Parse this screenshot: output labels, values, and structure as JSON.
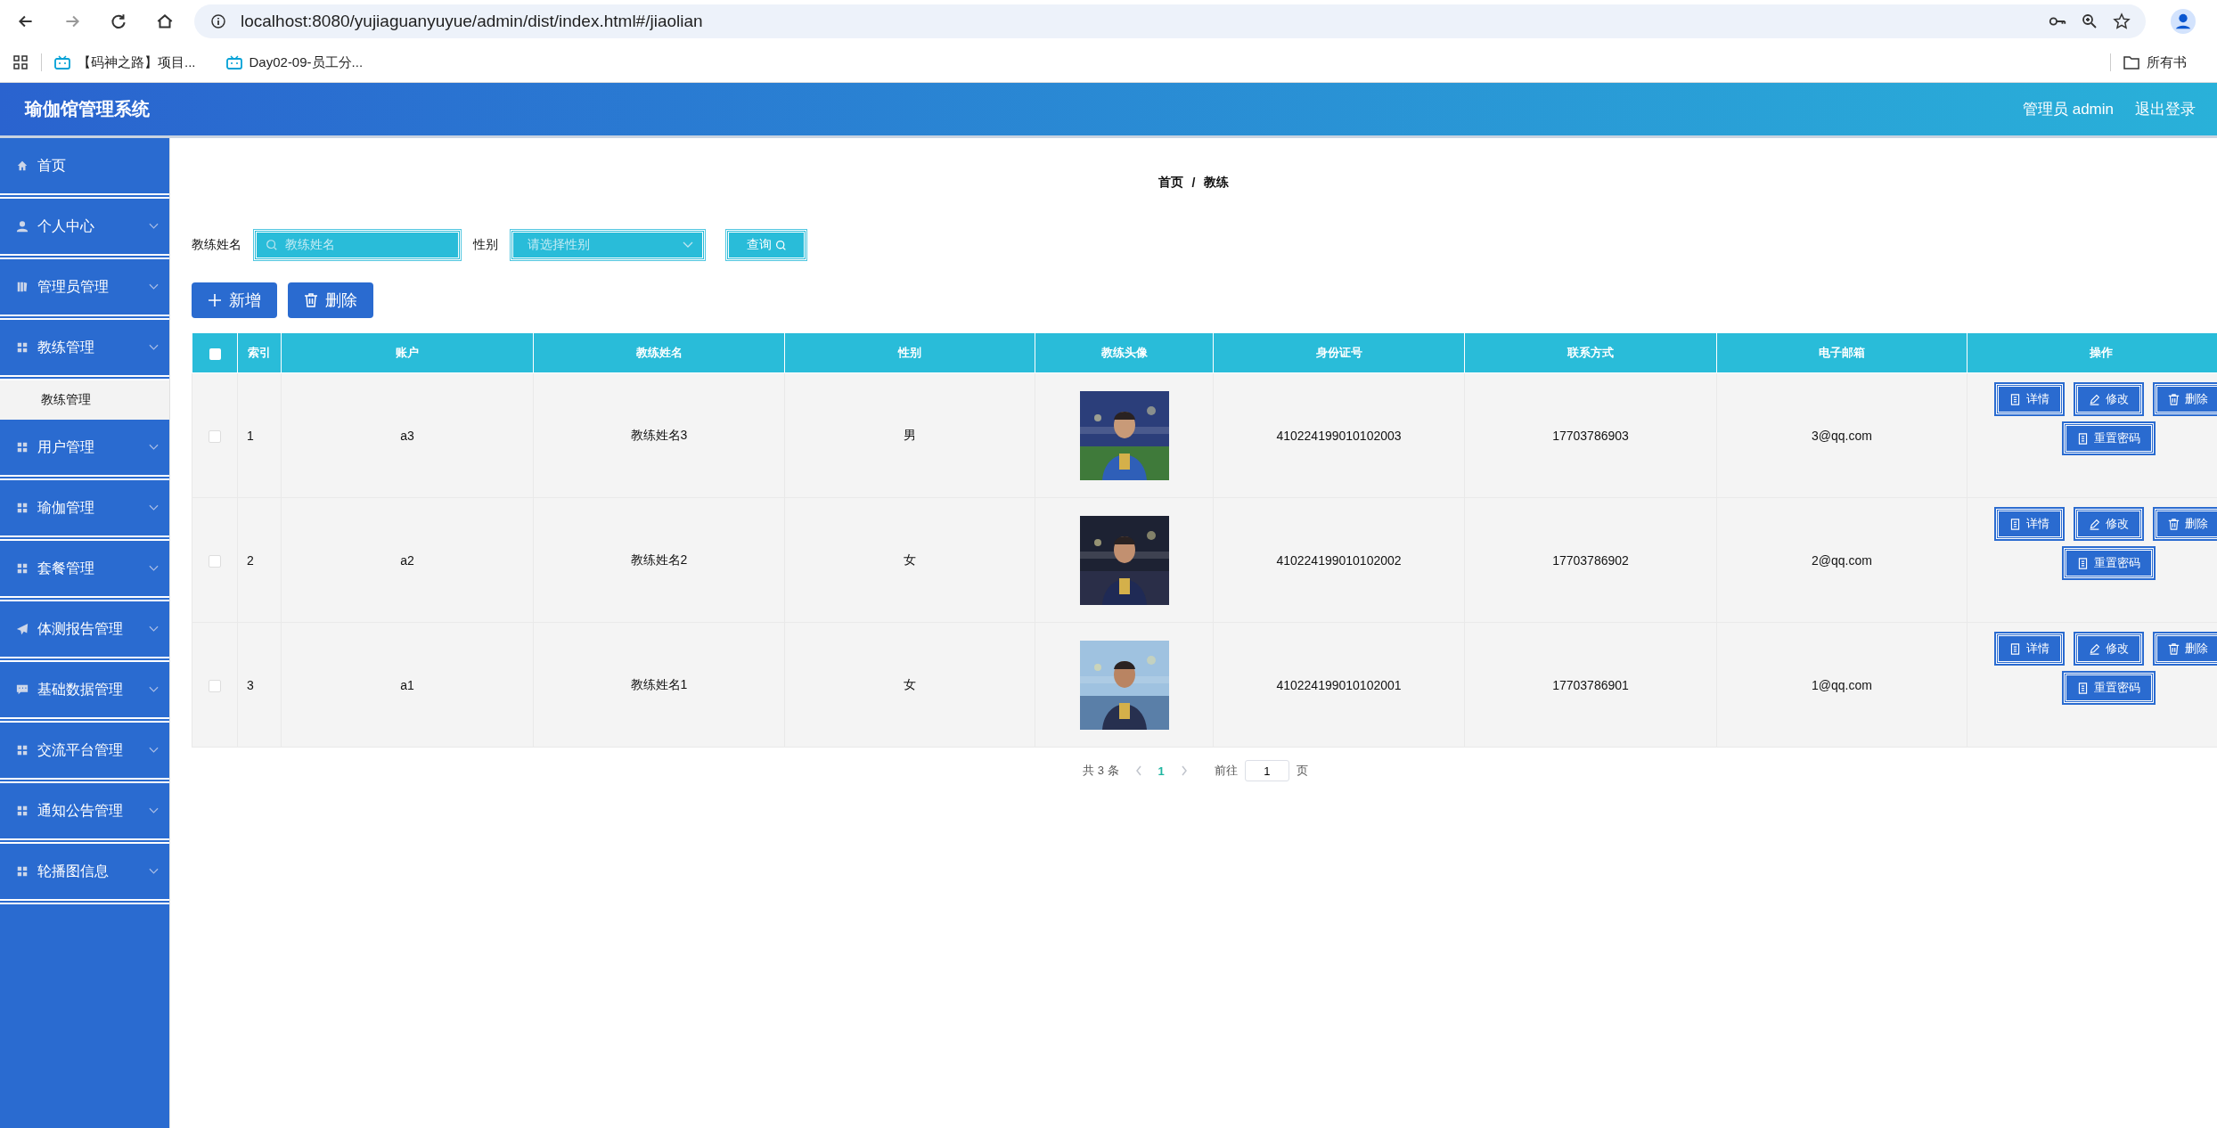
{
  "browser": {
    "url": "localhost:8080/yujiaguanyuyue/admin/dist/index.html#/jiaolian",
    "bookmarks": [
      "【码神之路】项目...",
      "Day02-09-员工分..."
    ],
    "all_bookmarks": "所有书"
  },
  "header": {
    "title": "瑜伽馆管理系统",
    "user": "管理员 admin",
    "logout": "退出登录"
  },
  "sidebar": {
    "items": [
      {
        "label": "首页"
      },
      {
        "label": "个人中心"
      },
      {
        "label": "管理员管理"
      },
      {
        "label": "教练管理",
        "children": [
          {
            "label": "教练管理",
            "selected": true
          }
        ]
      },
      {
        "label": "用户管理"
      },
      {
        "label": "瑜伽管理"
      },
      {
        "label": "套餐管理"
      },
      {
        "label": "体测报告管理"
      },
      {
        "label": "基础数据管理"
      },
      {
        "label": "交流平台管理"
      },
      {
        "label": "通知公告管理"
      },
      {
        "label": "轮播图信息"
      }
    ]
  },
  "breadcrumb": {
    "items": [
      "首页",
      "教练"
    ],
    "separator": "/"
  },
  "filters": {
    "name_label": "教练姓名",
    "name_placeholder": "教练姓名",
    "gender_label": "性别",
    "gender_placeholder": "请选择性别",
    "query": "查询"
  },
  "actions": [
    "新增",
    "删除"
  ],
  "table": {
    "columns": [
      "索引",
      "账户",
      "教练姓名",
      "性别",
      "教练头像",
      "身份证号",
      "联系方式",
      "电子邮箱",
      "操作"
    ],
    "header_checked": false,
    "rows": [
      {
        "checked": false,
        "index": "1",
        "account": "a3",
        "name": "教练姓名3",
        "gender": "男",
        "id_number": "410224199010102003",
        "phone": "17703786903",
        "email": "3@qq.com",
        "actions": [
          "详情",
          "修改",
          "删除",
          "重置密码"
        ]
      },
      {
        "checked": false,
        "index": "2",
        "account": "a2",
        "name": "教练姓名2",
        "gender": "女",
        "id_number": "410224199010102002",
        "phone": "17703786902",
        "email": "2@qq.com",
        "actions": [
          "详情",
          "修改",
          "删除",
          "重置密码"
        ]
      },
      {
        "checked": false,
        "index": "3",
        "account": "a1",
        "name": "教练姓名1",
        "gender": "女",
        "id_number": "410224199010102001",
        "phone": "17703786901",
        "email": "1@qq.com",
        "actions": [
          "详情",
          "修改",
          "删除",
          "重置密码"
        ]
      }
    ]
  },
  "pagination": {
    "total": "共 3 条",
    "pages": [
      {
        "label": "1",
        "selected": true
      }
    ],
    "goto": "前往",
    "page_input": "1",
    "page_suffix": "页"
  }
}
